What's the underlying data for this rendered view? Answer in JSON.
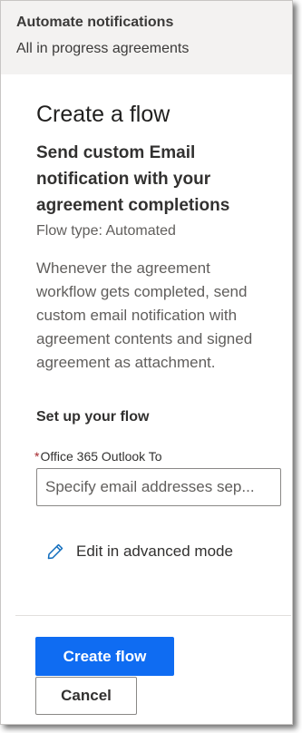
{
  "header": {
    "title": "Automate notifications",
    "subtitle": "All in progress agreements"
  },
  "page": {
    "title": "Create a flow",
    "flow_name": "Send custom Email notification with your agreement completions",
    "flow_type": "Flow type: Automated",
    "description": "Whenever the agreement workflow gets completed, send custom email notification with agreement contents and signed agreement as attachment."
  },
  "setup": {
    "heading": "Set up your flow",
    "required_marker": "*",
    "field_label": "Office 365 Outlook To",
    "field_placeholder": "Specify email addresses sep...",
    "field_value": ""
  },
  "advanced": {
    "label": "Edit in advanced mode",
    "icon": "pencil-icon"
  },
  "actions": {
    "create_label": "Create flow",
    "cancel_label": "Cancel"
  },
  "colors": {
    "primary": "#0f6cf2",
    "required": "#a4262c",
    "icon": "#0f6cbd"
  }
}
